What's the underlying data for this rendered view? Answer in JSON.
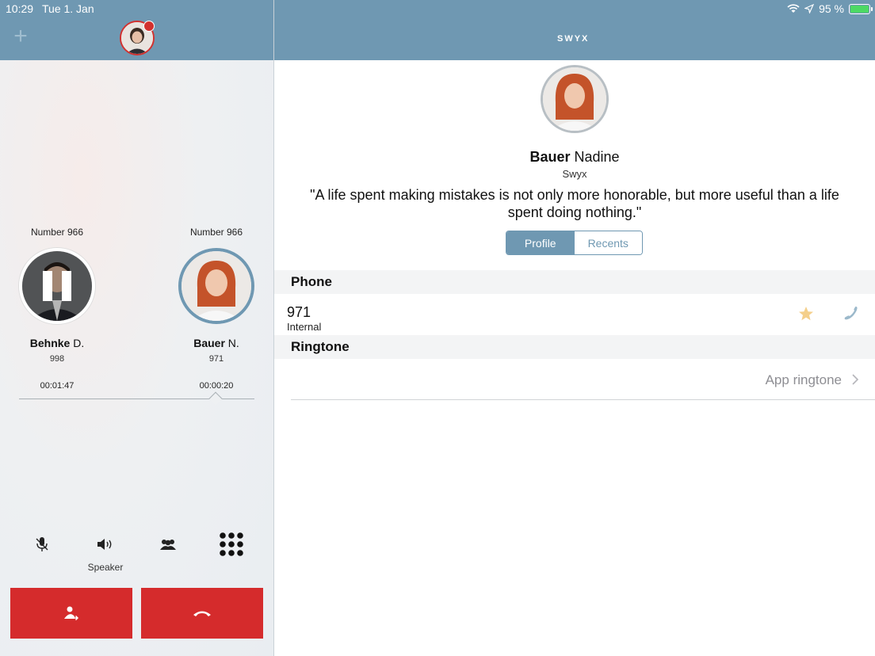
{
  "status": {
    "time": "10:29",
    "date": "Tue 1. Jan",
    "battery": "95 %"
  },
  "header": {
    "add_label": "+",
    "logo": "SWYX"
  },
  "callers": [
    {
      "number_label": "Number 966",
      "last_name": "Behnke",
      "first_initial": "D.",
      "extension": "998",
      "timer": "00:01:47",
      "state": "on-hold"
    },
    {
      "number_label": "Number 966",
      "last_name": "Bauer",
      "first_initial": "N.",
      "extension": "971",
      "timer": "00:00:20",
      "state": "active"
    }
  ],
  "controls": {
    "speaker_label": "Speaker",
    "icons": [
      "mute-icon",
      "speaker-icon",
      "conference-icon",
      "keypad-icon"
    ]
  },
  "actions": {
    "transfer_icon": "transfer-icon",
    "hangup_icon": "hangup-icon",
    "color": "#d52b2c"
  },
  "profile": {
    "last_name": "Bauer",
    "first_name": "Nadine",
    "company": "Swyx",
    "quote": "\"A life spent making mistakes is not only more honorable, but more useful than a life spent doing nothing.\"",
    "tabs": [
      "Profile",
      "Recents"
    ],
    "active_tab": "Profile"
  },
  "sections": {
    "phone_title": "Phone",
    "phone_number": "971",
    "phone_type": "Internal",
    "ringtone_title": "Ringtone",
    "ringtone_value": "App ringtone"
  },
  "colors": {
    "accent": "#6f98b2",
    "danger": "#d52b2c",
    "favorite": "#f4cf8a"
  }
}
